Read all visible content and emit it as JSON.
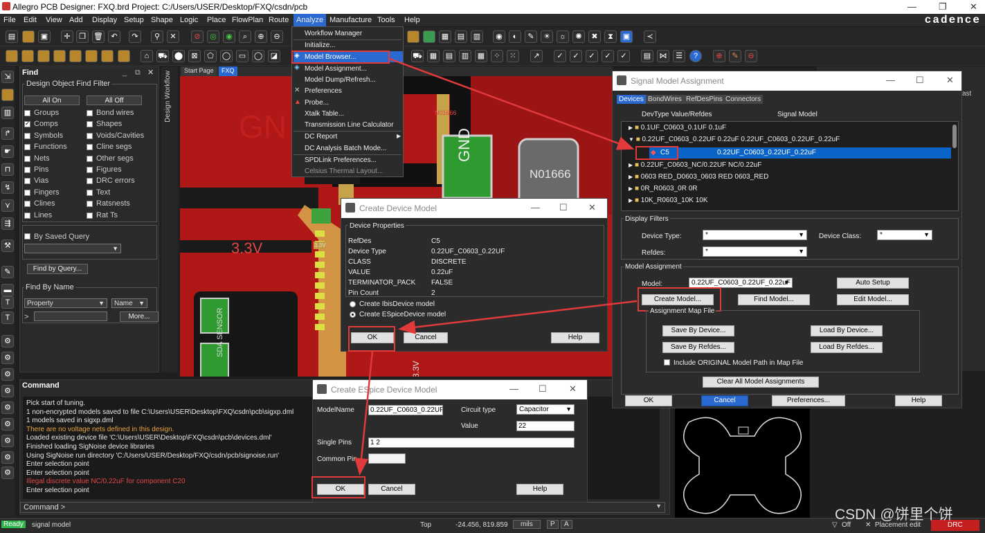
{
  "window": {
    "title": "Allegro PCB Designer: FXQ.brd  Project: C:/Users/USER/Desktop/FXQ/csdn/pcb",
    "min": "—",
    "max": "❐",
    "close": "✕"
  },
  "menu": [
    "File",
    "Edit",
    "View",
    "Add",
    "Display",
    "Setup",
    "Shape",
    "Logic",
    "Place",
    "FlowPlan",
    "Route",
    "Analyze",
    "Manufacture",
    "Tools",
    "Help"
  ],
  "brand": "cadence",
  "analyze_menu": [
    "Workflow Manager",
    "Initialize...",
    "Model Browser...",
    "Model Assignment...",
    "Model Dump/Refresh...",
    "Preferences",
    "Probe...",
    "Xtalk Table...",
    "Transmission Line Calculator",
    "DC Report",
    "DC Analysis Batch Mode...",
    "SPDLink Preferences...",
    "Celsius Thermal Layout..."
  ],
  "find": {
    "title": "Find",
    "filter_title": "Design Object Find Filter",
    "all_on": "All On",
    "all_off": "All Off",
    "col1": [
      "Groups",
      "Comps",
      "Symbols",
      "Functions",
      "Nets",
      "Pins",
      "Vias",
      "Fingers",
      "Clines",
      "Lines"
    ],
    "col2": [
      "Bond wires",
      "Shapes",
      "Voids/Cavities",
      "Cline segs",
      "Other segs",
      "Figures",
      "DRC errors",
      "Text",
      "Ratsnests",
      "Rat Ts"
    ],
    "by_saved_query": "By Saved Query",
    "find_by_query": "Find by Query...",
    "find_by_name": "Find By Name",
    "property": "Property",
    "name": "Name",
    "more": "More...",
    "arrow": ">"
  },
  "workflow_label": "Design Workflow",
  "tabs": [
    "Start Page",
    "FXQ"
  ],
  "canvas": {
    "gnd_big": "GN",
    "gnd": "GND",
    "n01666": "N01666",
    "n01666_small": "N01666",
    "v33": "3.3V",
    "v33_small": "3.3V",
    "sda": "SDA SENSOR",
    "v33_vert": "3.3V"
  },
  "command": {
    "title": "Command",
    "lines": [
      {
        "text": "Pick start of tuning.",
        "color": "#e8e8e8"
      },
      {
        "text": "1 non-encrypted models saved to file C:\\Users\\USER\\Desktop\\FXQ\\csdn\\pcb\\sigxp.dml",
        "color": "#e8e8e8"
      },
      {
        "text": "1 models saved in sigxp.dml",
        "color": "#e8e8e8"
      },
      {
        "text": "There are no voltage nets defined in this design.",
        "color": "#e8a13a"
      },
      {
        "text": "Loaded existing device file 'C:\\Users\\USER\\Desktop\\FXQ\\csdn\\pcb\\devices.dml'",
        "color": "#e8e8e8"
      },
      {
        "text": "Finished loading SigNoise device libraries",
        "color": "#e8e8e8"
      },
      {
        "text": "Using SigNoise run directory 'C:/Users/USER/Desktop/FXQ/csdn/pcb/signoise.run'",
        "color": "#e8e8e8"
      },
      {
        "text": "Enter selection point",
        "color": "#e8e8e8"
      },
      {
        "text": "Enter selection point",
        "color": "#e8e8e8"
      },
      {
        "text": "Illegal discrete value NC/0.22uF for component C20",
        "color": "#e04848"
      },
      {
        "text": "Enter selection point",
        "color": "#e8e8e8"
      }
    ],
    "prompt": "Command >"
  },
  "status": {
    "ready": "Ready",
    "mode": "signal model",
    "layer": "Top",
    "coords": "-24.456, 819.859",
    "units": "mils",
    "p": "P",
    "a": "A",
    "off": "Off",
    "placement": "Placement edit",
    "drc": "DRC"
  },
  "watermark": "CSDN @饼里个饼",
  "sma": {
    "title": "Signal Model Assignment",
    "tabs": [
      "Devices",
      "BondWires",
      "RefDesPins",
      "Connectors"
    ],
    "col_devtype": "DevType Value/Refdes",
    "col_model": "Signal Model",
    "tree": [
      {
        "label": "0.1UF_C0603_0.1UF 0.1uF",
        "model": ""
      },
      {
        "label": "0.22UF_C0603_0.22UF 0.22uF 0.22UF_C0603_0.22UF_0.22uF",
        "model": ""
      },
      {
        "label": "C5",
        "model": "0.22UF_C0603_0.22UF_0.22uF"
      },
      {
        "label": "0.22UF_C0603_NC/0.22UF NC/0.22uF",
        "model": ""
      },
      {
        "label": "0603 RED_D0603_0603 RED 0603_RED",
        "model": ""
      },
      {
        "label": "0R_R0603_0R 0R",
        "model": ""
      },
      {
        "label": "10K_R0603_10K 10K",
        "model": ""
      }
    ],
    "display_filters": "Display Filters",
    "device_type_label": "Device Type:",
    "device_type": "*",
    "device_class_label": "Device Class:",
    "device_class": "*",
    "refdes_label": "Refdes:",
    "refdes": "*",
    "model_assignment": "Model Assignment",
    "model_label": "Model:",
    "model": "0.22UF_C0603_0.22UF_0.22uF",
    "auto_setup": "Auto Setup",
    "create_model": "Create Model...",
    "find_model": "Find Model...",
    "edit_model": "Edit Model...",
    "map_file": "Assignment Map File",
    "save_by_device": "Save By Device...",
    "load_by_device": "Load By Device...",
    "save_by_refdes": "Save By Refdes...",
    "load_by_refdes": "Load By Refdes...",
    "include_original": "Include ORIGINAL Model Path in Map File",
    "clear_all": "Clear All Model Assignments",
    "ok": "OK",
    "cancel": "Cancel",
    "preferences": "Preferences...",
    "help": "Help"
  },
  "cdm": {
    "title": "Create Device Model",
    "group": "Device Properties",
    "props": [
      {
        "k": "RefDes",
        "v": "C5"
      },
      {
        "k": "Device Type",
        "v": "0.22UF_C0603_0.22UF"
      },
      {
        "k": "CLASS",
        "v": "DISCRETE"
      },
      {
        "k": "VALUE",
        "v": "0.22uF"
      },
      {
        "k": "TERMINATOR_PACK",
        "v": "FALSE"
      },
      {
        "k": "Pin Count",
        "v": "2"
      }
    ],
    "ibis": "Create IbisDevice model",
    "espice": "Create ESpiceDevice model",
    "ok": "OK",
    "cancel": "Cancel",
    "help": "Help"
  },
  "esp": {
    "title": "Create ESpice Device Model",
    "model_name_label": "ModelName",
    "model_name": "0.22UF_C0603_0.22UF_0.",
    "circuit_type_label": "Circuit type",
    "circuit_type": "Capacitor",
    "value_label": "Value",
    "value": "22",
    "single_pins_label": "Single Pins",
    "single_pins": "1 2",
    "common_pin_label": "Common Pin",
    "common_pin": "",
    "ok": "OK",
    "cancel": "Cancel",
    "help": "Help"
  },
  "colors": {
    "accent": "#2a6ad0",
    "highlight": "#e23a3a",
    "selection": "#0a64c8"
  }
}
